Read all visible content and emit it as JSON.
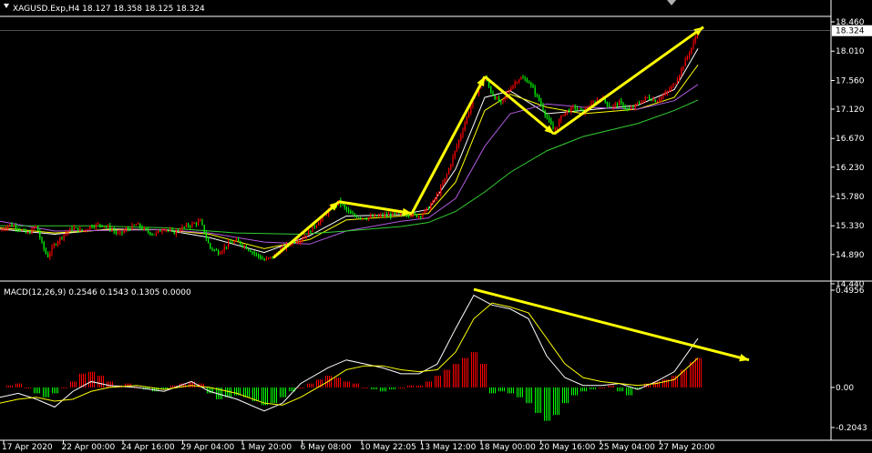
{
  "header": {
    "symbol_info": "XAGUSD.Exp,H4  18.127 18.358 18.125 18.324",
    "indicator_info": "MACD(12,26,9) 0.2546 0.1543 0.1305 0.0000"
  },
  "price_axis": {
    "ticks": [
      "18.460",
      "18.010",
      "17.560",
      "17.120",
      "16.670",
      "16.230",
      "15.780",
      "15.330",
      "14.890",
      "14.440"
    ],
    "current_price": "18.324"
  },
  "macd_axis": {
    "ticks": [
      "0.4956",
      "0.00",
      "-0.2043"
    ]
  },
  "time_axis": {
    "labels": [
      "17 Apr 2020",
      "22 Apr 00:00",
      "24 Apr 16:00",
      "29 Apr 04:00",
      "1 May 20:00",
      "6 May 08:00",
      "10 May 22:05",
      "13 May 12:00",
      "18 May 00:00",
      "20 May 16:00",
      "25 May 04:00",
      "27 May 20:00"
    ]
  },
  "colors": {
    "background": "#000000",
    "grid_line": "#ffffff",
    "bull_candle": "#ff0000",
    "bear_candle": "#00ff00",
    "ma_fast": "#ffffff",
    "ma_yellow": "#ffff00",
    "ma_mid": "#b05ae0",
    "ma_slow": "#32cd32",
    "annotation_arrow": "#ffff00",
    "macd_hist_pos": "#ff0000",
    "macd_hist_neg": "#00ff00"
  },
  "chart_data": {
    "type": "candlestick",
    "symbol": "XAGUSD.Exp",
    "timeframe": "H4",
    "ohlc_last": {
      "open": 18.127,
      "high": 18.358,
      "low": 18.125,
      "close": 18.324
    },
    "price_range": [
      14.44,
      18.46
    ],
    "close_path": [
      [
        0,
        15.25
      ],
      [
        10,
        15.35
      ],
      [
        20,
        15.3
      ],
      [
        30,
        15.2
      ],
      [
        40,
        15.33
      ],
      [
        46,
        15.05
      ],
      [
        52,
        14.85
      ],
      [
        60,
        15.05
      ],
      [
        70,
        15.2
      ],
      [
        80,
        15.3
      ],
      [
        90,
        15.25
      ],
      [
        100,
        15.33
      ],
      [
        110,
        15.35
      ],
      [
        120,
        15.3
      ],
      [
        130,
        15.2
      ],
      [
        140,
        15.28
      ],
      [
        150,
        15.35
      ],
      [
        160,
        15.25
      ],
      [
        170,
        15.2
      ],
      [
        180,
        15.3
      ],
      [
        190,
        15.22
      ],
      [
        200,
        15.3
      ],
      [
        210,
        15.35
      ],
      [
        220,
        15.4
      ],
      [
        230,
        15.0
      ],
      [
        240,
        14.92
      ],
      [
        250,
        15.05
      ],
      [
        260,
        15.1
      ],
      [
        270,
        15.0
      ],
      [
        280,
        14.9
      ],
      [
        290,
        14.8
      ],
      [
        300,
        14.86
      ],
      [
        310,
        14.98
      ],
      [
        320,
        15.08
      ],
      [
        330,
        15.12
      ],
      [
        340,
        15.25
      ],
      [
        350,
        15.4
      ],
      [
        360,
        15.55
      ],
      [
        372,
        15.7
      ],
      [
        385,
        15.5
      ],
      [
        400,
        15.45
      ],
      [
        415,
        15.48
      ],
      [
        430,
        15.5
      ],
      [
        445,
        15.52
      ],
      [
        460,
        15.48
      ],
      [
        470,
        15.6
      ],
      [
        480,
        15.8
      ],
      [
        490,
        16.1
      ],
      [
        500,
        16.5
      ],
      [
        510,
        16.9
      ],
      [
        520,
        17.3
      ],
      [
        532,
        17.62
      ],
      [
        540,
        17.35
      ],
      [
        550,
        17.2
      ],
      [
        560,
        17.45
      ],
      [
        570,
        17.6
      ],
      [
        580,
        17.55
      ],
      [
        590,
        17.3
      ],
      [
        600,
        17.0
      ],
      [
        608,
        16.78
      ],
      [
        618,
        17.05
      ],
      [
        630,
        17.15
      ],
      [
        640,
        17.08
      ],
      [
        650,
        17.2
      ],
      [
        660,
        17.3
      ],
      [
        670,
        17.15
      ],
      [
        680,
        17.22
      ],
      [
        690,
        17.1
      ],
      [
        700,
        17.2
      ],
      [
        710,
        17.3
      ],
      [
        720,
        17.25
      ],
      [
        730,
        17.35
      ],
      [
        740,
        17.5
      ],
      [
        750,
        17.8
      ],
      [
        760,
        18.1
      ],
      [
        766,
        18.324
      ]
    ],
    "moving_averages": [
      {
        "color": "#ffffff",
        "points": [
          [
            0,
            15.28
          ],
          [
            60,
            15.2
          ],
          [
            120,
            15.28
          ],
          [
            180,
            15.27
          ],
          [
            230,
            15.15
          ],
          [
            290,
            14.92
          ],
          [
            340,
            15.18
          ],
          [
            380,
            15.48
          ],
          [
            440,
            15.5
          ],
          [
            470,
            15.58
          ],
          [
            500,
            16.2
          ],
          [
            532,
            17.3
          ],
          [
            560,
            17.4
          ],
          [
            600,
            17.05
          ],
          [
            640,
            17.1
          ],
          [
            700,
            17.18
          ],
          [
            740,
            17.42
          ],
          [
            766,
            18.05
          ]
        ]
      },
      {
        "color": "#ffff00",
        "points": [
          [
            0,
            15.3
          ],
          [
            60,
            15.22
          ],
          [
            120,
            15.27
          ],
          [
            180,
            15.27
          ],
          [
            230,
            15.2
          ],
          [
            290,
            14.98
          ],
          [
            340,
            15.12
          ],
          [
            380,
            15.42
          ],
          [
            440,
            15.48
          ],
          [
            470,
            15.52
          ],
          [
            500,
            16.0
          ],
          [
            532,
            17.1
          ],
          [
            560,
            17.35
          ],
          [
            600,
            17.15
          ],
          [
            640,
            17.05
          ],
          [
            700,
            17.12
          ],
          [
            740,
            17.3
          ],
          [
            766,
            17.8
          ]
        ]
      },
      {
        "color": "#b05ae0",
        "points": [
          [
            0,
            15.4
          ],
          [
            60,
            15.25
          ],
          [
            120,
            15.26
          ],
          [
            180,
            15.27
          ],
          [
            230,
            15.22
          ],
          [
            290,
            15.08
          ],
          [
            340,
            15.05
          ],
          [
            380,
            15.25
          ],
          [
            440,
            15.4
          ],
          [
            470,
            15.45
          ],
          [
            500,
            15.75
          ],
          [
            532,
            16.55
          ],
          [
            560,
            17.05
          ],
          [
            600,
            17.2
          ],
          [
            640,
            17.15
          ],
          [
            700,
            17.12
          ],
          [
            740,
            17.25
          ],
          [
            766,
            17.5
          ]
        ]
      },
      {
        "color": "#32cd32",
        "points": [
          [
            0,
            15.33
          ],
          [
            100,
            15.33
          ],
          [
            180,
            15.3
          ],
          [
            260,
            15.22
          ],
          [
            330,
            15.2
          ],
          [
            380,
            15.25
          ],
          [
            440,
            15.32
          ],
          [
            470,
            15.38
          ],
          [
            500,
            15.55
          ],
          [
            532,
            15.85
          ],
          [
            560,
            16.15
          ],
          [
            600,
            16.48
          ],
          [
            640,
            16.7
          ],
          [
            700,
            16.9
          ],
          [
            740,
            17.1
          ],
          [
            766,
            17.26
          ]
        ]
      }
    ],
    "annotations_price": [
      {
        "from": [
          300,
          14.84
        ],
        "to": [
          372,
          15.7
        ]
      },
      {
        "from": [
          372,
          15.7
        ],
        "to": [
          452,
          15.52
        ]
      },
      {
        "from": [
          452,
          15.52
        ],
        "to": [
          532,
          17.62
        ]
      },
      {
        "from": [
          532,
          17.62
        ],
        "to": [
          608,
          16.74
        ]
      },
      {
        "from": [
          608,
          16.74
        ],
        "to": [
          772,
          18.38
        ]
      }
    ],
    "macd": {
      "title": "MACD(12,26,9) 0.2546 0.1543 0.1305 0.0000",
      "range": [
        -0.2043,
        0.4956
      ],
      "histogram": [
        [
          10,
          0.01
        ],
        [
          20,
          0.02
        ],
        [
          30,
          0.0
        ],
        [
          40,
          -0.03
        ],
        [
          50,
          -0.05
        ],
        [
          60,
          -0.03
        ],
        [
          70,
          0.0
        ],
        [
          80,
          0.03
        ],
        [
          90,
          0.07
        ],
        [
          100,
          0.08
        ],
        [
          110,
          0.06
        ],
        [
          120,
          0.03
        ],
        [
          130,
          0.01
        ],
        [
          140,
          0.02
        ],
        [
          150,
          0.0
        ],
        [
          160,
          -0.01
        ],
        [
          170,
          -0.02
        ],
        [
          180,
          -0.01
        ],
        [
          190,
          0.01
        ],
        [
          200,
          0.02
        ],
        [
          210,
          0.03
        ],
        [
          220,
          0.02
        ],
        [
          230,
          -0.03
        ],
        [
          240,
          -0.06
        ],
        [
          250,
          -0.05
        ],
        [
          260,
          -0.04
        ],
        [
          270,
          -0.05
        ],
        [
          280,
          -0.07
        ],
        [
          290,
          -0.09
        ],
        [
          300,
          -0.08
        ],
        [
          310,
          -0.05
        ],
        [
          320,
          -0.02
        ],
        [
          330,
          0.0
        ],
        [
          340,
          0.02
        ],
        [
          350,
          0.04
        ],
        [
          360,
          0.06
        ],
        [
          370,
          0.05
        ],
        [
          380,
          0.03
        ],
        [
          390,
          0.02
        ],
        [
          400,
          0.0
        ],
        [
          410,
          -0.01
        ],
        [
          420,
          -0.02
        ],
        [
          430,
          -0.01
        ],
        [
          440,
          0.0
        ],
        [
          450,
          0.01
        ],
        [
          460,
          0.01
        ],
        [
          470,
          0.03
        ],
        [
          480,
          0.06
        ],
        [
          490,
          0.09
        ],
        [
          500,
          0.12
        ],
        [
          510,
          0.15
        ],
        [
          520,
          0.18
        ],
        [
          530,
          0.12
        ],
        [
          540,
          -0.03
        ],
        [
          550,
          -0.02
        ],
        [
          560,
          -0.03
        ],
        [
          570,
          -0.05
        ],
        [
          580,
          -0.08
        ],
        [
          590,
          -0.13
        ],
        [
          600,
          -0.17
        ],
        [
          610,
          -0.14
        ],
        [
          620,
          -0.08
        ],
        [
          630,
          -0.04
        ],
        [
          640,
          -0.02
        ],
        [
          650,
          -0.01
        ],
        [
          660,
          0.0
        ],
        [
          670,
          0.01
        ],
        [
          680,
          -0.02
        ],
        [
          690,
          -0.04
        ],
        [
          700,
          -0.01
        ],
        [
          710,
          0.02
        ],
        [
          720,
          0.03
        ],
        [
          730,
          0.04
        ],
        [
          740,
          0.06
        ],
        [
          750,
          0.09
        ],
        [
          760,
          0.13
        ],
        [
          766,
          0.15
        ]
      ],
      "main_line": [
        [
          0,
          -0.05
        ],
        [
          20,
          -0.03
        ],
        [
          40,
          -0.06
        ],
        [
          60,
          -0.1
        ],
        [
          80,
          -0.02
        ],
        [
          100,
          0.03
        ],
        [
          120,
          0.01
        ],
        [
          150,
          0.0
        ],
        [
          180,
          -0.02
        ],
        [
          210,
          0.03
        ],
        [
          230,
          -0.02
        ],
        [
          260,
          -0.06
        ],
        [
          290,
          -0.12
        ],
        [
          310,
          -0.08
        ],
        [
          330,
          0.02
        ],
        [
          360,
          0.1
        ],
        [
          380,
          0.14
        ],
        [
          400,
          0.12
        ],
        [
          420,
          0.1
        ],
        [
          440,
          0.07
        ],
        [
          460,
          0.07
        ],
        [
          480,
          0.12
        ],
        [
          500,
          0.3
        ],
        [
          520,
          0.47
        ],
        [
          540,
          0.42
        ],
        [
          560,
          0.4
        ],
        [
          580,
          0.35
        ],
        [
          600,
          0.16
        ],
        [
          620,
          0.05
        ],
        [
          640,
          0.01
        ],
        [
          660,
          0.01
        ],
        [
          680,
          0.02
        ],
        [
          700,
          -0.01
        ],
        [
          720,
          0.03
        ],
        [
          740,
          0.08
        ],
        [
          766,
          0.25
        ]
      ],
      "signal_line": [
        [
          0,
          -0.08
        ],
        [
          20,
          -0.06
        ],
        [
          40,
          -0.05
        ],
        [
          60,
          -0.07
        ],
        [
          80,
          -0.06
        ],
        [
          100,
          -0.02
        ],
        [
          120,
          0.0
        ],
        [
          150,
          0.01
        ],
        [
          180,
          -0.01
        ],
        [
          210,
          0.01
        ],
        [
          230,
          0.0
        ],
        [
          260,
          -0.03
        ],
        [
          290,
          -0.08
        ],
        [
          310,
          -0.09
        ],
        [
          330,
          -0.05
        ],
        [
          360,
          0.03
        ],
        [
          380,
          0.09
        ],
        [
          400,
          0.11
        ],
        [
          420,
          0.11
        ],
        [
          440,
          0.09
        ],
        [
          460,
          0.08
        ],
        [
          480,
          0.09
        ],
        [
          500,
          0.18
        ],
        [
          520,
          0.35
        ],
        [
          540,
          0.43
        ],
        [
          560,
          0.41
        ],
        [
          580,
          0.38
        ],
        [
          600,
          0.25
        ],
        [
          620,
          0.12
        ],
        [
          640,
          0.05
        ],
        [
          660,
          0.03
        ],
        [
          680,
          0.02
        ],
        [
          700,
          0.01
        ],
        [
          720,
          0.02
        ],
        [
          740,
          0.04
        ],
        [
          766,
          0.15
        ]
      ],
      "annotation": {
        "from": [
          520,
          0.5
        ],
        "to": [
          822,
          0.14
        ]
      }
    }
  }
}
